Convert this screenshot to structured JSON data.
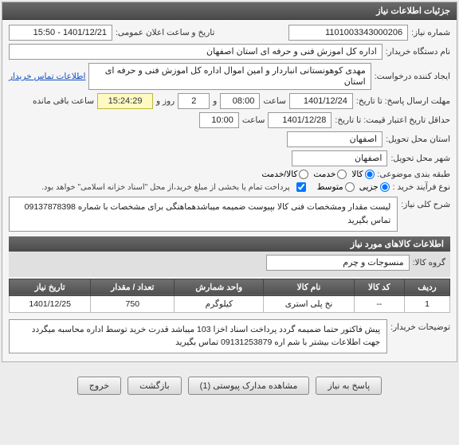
{
  "panelTitle": "جزئیات اطلاعات نیاز",
  "fields": {
    "needNoLabel": "شماره نیاز:",
    "needNo": "1101003343000206",
    "announceLabel": "تاریخ و ساعت اعلان عمومی:",
    "announce": "1401/12/21 - 15:50",
    "buyerLabel": "نام دستگاه خریدار:",
    "buyer": "اداره کل اموزش فنی و حرفه ای استان اصفهان",
    "requesterLabel": "ایجاد کننده درخواست:",
    "requester": "مهدی کوهونستانی انباردار و امین اموال اداره کل اموزش فنی و حرفه ای استان",
    "contactLink": "اطلاعات تماس خریدار",
    "deadlineLabel": "مهلت ارسال پاسخ: تا تاریخ:",
    "deadlineDate": "1401/12/24",
    "timeLabel": "ساعت",
    "deadlineTime": "08:00",
    "dayLabel": "و",
    "days": "2",
    "daysAfter": "روز و",
    "remain": "15:24:29",
    "remainAfter": "ساعت باقی مانده",
    "validLabel": "حداقل تاریخ اعتبار قیمت: تا تاریخ:",
    "validDate": "1401/12/28",
    "validTime": "10:00",
    "provinceLabel": "استان محل تحویل:",
    "province": "اصفهان",
    "cityLabel": "شهر محل تحویل:",
    "city": "اصفهان",
    "classLabel": "طبقه بندی موضوعی:",
    "purchaseTypeLabel": "نوع فرآیند خرید :",
    "paymentNote": "پرداخت تمام یا بخشی از مبلغ خرید،از محل \"اسناد خزانه اسلامی\" خواهد بود."
  },
  "classOptions": {
    "goods": "کالا",
    "service": "خدمت",
    "both": "کالا/خدمت"
  },
  "purchaseOptions": {
    "small": "جزیی",
    "medium": "متوسط"
  },
  "descLabel": "شرح کلی نیاز:",
  "descText": "لیست مقدار ومشخصات فنی کالا بپیوست ضمیمه میباشدهماهنگی برای مشخصات با شماره 09137878398 تماس بگیرید",
  "goodsSection": "اطلاعات کالاهای مورد نیاز",
  "groupLabel": "گروه کالا:",
  "groupValue": "منسوجات و چرم",
  "table": {
    "headers": {
      "row": "ردیف",
      "code": "کد کالا",
      "name": "نام کالا",
      "unit": "واحد شمارش",
      "qty": "تعداد / مقدار",
      "date": "تاریخ نیاز"
    },
    "rows": [
      {
        "row": "1",
        "code": "--",
        "name": "نخ پلی استری",
        "unit": "کیلوگرم",
        "qty": "750",
        "date": "1401/12/25"
      }
    ]
  },
  "buyerNoteLabel": "توضیحات خریدار:",
  "buyerNote": "پیش فاکتور حتما ضمیمه گردد پرداخت اسناد اخزا 103 میباشد قدرت خرید توسط اداره محاسبه میگردد جهت اطلاعات بیشتر با شم اره 09131253879 تماس بگیرید",
  "buttons": {
    "respond": "پاسخ به نیاز",
    "attachments": "مشاهده مدارک پیوستی (1)",
    "back": "بازگشت",
    "exit": "خروج"
  }
}
